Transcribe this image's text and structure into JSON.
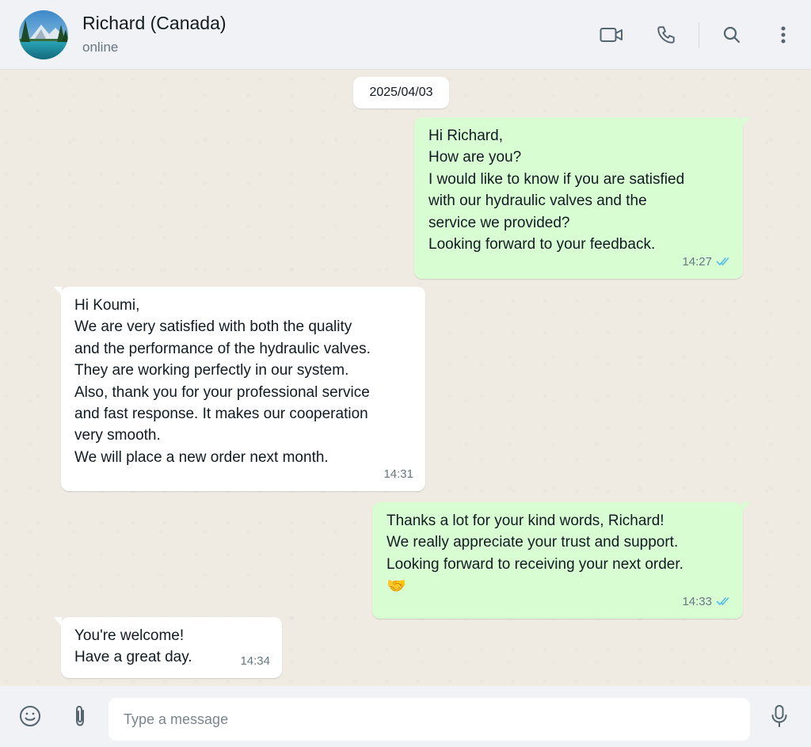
{
  "header": {
    "contact_name": "Richard (Canada)",
    "status": "online",
    "icons": [
      "video-call-icon",
      "voice-call-icon",
      "search-icon",
      "menu-icon"
    ]
  },
  "chat": {
    "date": "2025/04/03",
    "messages": [
      {
        "direction": "outgoing",
        "text": "Hi Richard,\nHow are you?\nI would like to know if you are satisfied\nwith our hydraulic valves and the\nservice we provided?\nLooking forward to your feedback.",
        "time": "14:27",
        "read": true
      },
      {
        "direction": "incoming",
        "text": "Hi Koumi,\nWe are very satisfied with both the quality\nand the performance of the hydraulic valves.\nThey are working perfectly in our system.\nAlso, thank you for your professional service\nand fast response. It makes our cooperation\nvery smooth.\nWe will place a new order next month.",
        "time": "14:31"
      },
      {
        "direction": "outgoing",
        "text": "Thanks a lot for your kind words, Richard!\nWe really appreciate your trust and support.\nLooking forward to receiving your next order.",
        "emoji": "🤝",
        "time": "14:33",
        "read": true
      },
      {
        "direction": "incoming",
        "text": "You're welcome!\nHave a great day.",
        "time": "14:34"
      }
    ]
  },
  "footer": {
    "placeholder": "Type a message",
    "icons": [
      "emoji-icon",
      "attach-icon",
      "microphone-icon"
    ]
  },
  "colors": {
    "outgoing_bubble": "#d9fdd3",
    "incoming_bubble": "#ffffff",
    "read_tick": "#53bdeb",
    "chat_background": "#efeae2"
  }
}
